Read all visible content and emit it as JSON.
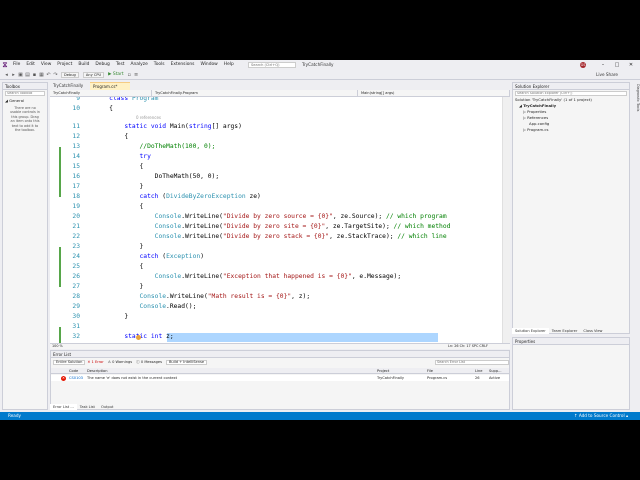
{
  "menu": {
    "items": [
      "File",
      "Edit",
      "View",
      "Project",
      "Build",
      "Debug",
      "Test",
      "Analyze",
      "Tools",
      "Extensions",
      "Window",
      "Help"
    ],
    "search_placeholder": "Search (Ctrl+Q)",
    "window_title": "TryCatchFinally",
    "avatar": "GS",
    "win_controls": [
      "–",
      "□",
      "✕"
    ]
  },
  "toolbar": {
    "config": "Debug",
    "platform": "Any CPU",
    "start_label": "▶ Start",
    "live_share": "Live Share"
  },
  "toolbox": {
    "title": "Toolbox",
    "search_placeholder": "Search Toolbox",
    "group": "◢ General",
    "message": "There are no usable controls in this group. Drag an item onto this text to add it to the toolbox."
  },
  "editor": {
    "tabs": [
      "TryCatchFinally",
      "Program.cs*"
    ],
    "nav": [
      "TryCatchFinally",
      "TryCatchFinally.Program",
      "Main(string[] args)"
    ],
    "refs_label": "0 references",
    "lines": [
      {
        "n": "9",
        "tokens": [
          {
            "t": "    ",
            "c": ""
          },
          {
            "t": "class",
            "c": "kw"
          },
          {
            "t": " ",
            "c": ""
          },
          {
            "t": "Program",
            "c": "ty"
          }
        ]
      },
      {
        "n": "10",
        "tokens": [
          {
            "t": "    {",
            "c": ""
          }
        ]
      },
      {
        "n": "11",
        "tokens": [
          {
            "t": "        ",
            "c": ""
          },
          {
            "t": "static",
            "c": "kw"
          },
          {
            "t": " ",
            "c": ""
          },
          {
            "t": "void",
            "c": "kw"
          },
          {
            "t": " Main(",
            "c": ""
          },
          {
            "t": "string",
            "c": "kw"
          },
          {
            "t": "[] args)",
            "c": ""
          }
        ]
      },
      {
        "n": "12",
        "tokens": [
          {
            "t": "        {",
            "c": ""
          }
        ]
      },
      {
        "n": "13",
        "tokens": [
          {
            "t": "            ",
            "c": ""
          },
          {
            "t": "//DoTheMath(100, 0);",
            "c": "cm"
          }
        ]
      },
      {
        "n": "14",
        "tokens": [
          {
            "t": "            ",
            "c": ""
          },
          {
            "t": "try",
            "c": "kw"
          }
        ]
      },
      {
        "n": "15",
        "tokens": [
          {
            "t": "            {",
            "c": ""
          }
        ]
      },
      {
        "n": "16",
        "tokens": [
          {
            "t": "                DoTheMath(50, 0);",
            "c": ""
          }
        ]
      },
      {
        "n": "17",
        "tokens": [
          {
            "t": "            }",
            "c": ""
          }
        ]
      },
      {
        "n": "18",
        "tokens": [
          {
            "t": "            ",
            "c": ""
          },
          {
            "t": "catch",
            "c": "kw"
          },
          {
            "t": " (",
            "c": ""
          },
          {
            "t": "DivideByZeroException",
            "c": "ty"
          },
          {
            "t": " ze)",
            "c": ""
          }
        ]
      },
      {
        "n": "19",
        "tokens": [
          {
            "t": "            {",
            "c": ""
          }
        ]
      },
      {
        "n": "20",
        "tokens": [
          {
            "t": "                ",
            "c": ""
          },
          {
            "t": "Console",
            "c": "ty"
          },
          {
            "t": ".WriteLine(",
            "c": ""
          },
          {
            "t": "\"Divide by zero source = {0}\"",
            "c": "str"
          },
          {
            "t": ", ze.Source); ",
            "c": ""
          },
          {
            "t": "// which program",
            "c": "cm"
          }
        ]
      },
      {
        "n": "21",
        "tokens": [
          {
            "t": "                ",
            "c": ""
          },
          {
            "t": "Console",
            "c": "ty"
          },
          {
            "t": ".WriteLine(",
            "c": ""
          },
          {
            "t": "\"Divide by zero site = {0}\"",
            "c": "str"
          },
          {
            "t": ", ze.TargetSite); ",
            "c": ""
          },
          {
            "t": "// which method",
            "c": "cm"
          }
        ]
      },
      {
        "n": "22",
        "tokens": [
          {
            "t": "                ",
            "c": ""
          },
          {
            "t": "Console",
            "c": "ty"
          },
          {
            "t": ".WriteLine(",
            "c": ""
          },
          {
            "t": "\"Divide by zero stack = {0}\"",
            "c": "str"
          },
          {
            "t": ", ze.StackTrace); ",
            "c": ""
          },
          {
            "t": "// which line",
            "c": "cm"
          }
        ]
      },
      {
        "n": "23",
        "tokens": [
          {
            "t": "            }",
            "c": ""
          }
        ]
      },
      {
        "n": "24",
        "tokens": [
          {
            "t": "            ",
            "c": ""
          },
          {
            "t": "catch",
            "c": "kw"
          },
          {
            "t": " (",
            "c": ""
          },
          {
            "t": "Exception",
            "c": "ty"
          },
          {
            "t": ")",
            "c": ""
          }
        ]
      },
      {
        "n": "25",
        "tokens": [
          {
            "t": "            {",
            "c": ""
          }
        ]
      },
      {
        "n": "26",
        "tokens": [
          {
            "t": "                ",
            "c": ""
          },
          {
            "t": "Console",
            "c": "ty"
          },
          {
            "t": ".WriteLine(",
            "c": ""
          },
          {
            "t": "\"Exception that happened is = {0}\"",
            "c": "str"
          },
          {
            "t": ", e.Message);",
            "c": ""
          }
        ]
      },
      {
        "n": "27",
        "tokens": [
          {
            "t": "            }",
            "c": ""
          }
        ]
      },
      {
        "n": "28",
        "tokens": [
          {
            "t": "            ",
            "c": ""
          },
          {
            "t": "Console",
            "c": "ty"
          },
          {
            "t": ".WriteLine(",
            "c": ""
          },
          {
            "t": "\"Math result is = {0}\"",
            "c": "str"
          },
          {
            "t": ", z);",
            "c": ""
          }
        ]
      },
      {
        "n": "29",
        "tokens": [
          {
            "t": "            ",
            "c": ""
          },
          {
            "t": "Console",
            "c": "ty"
          },
          {
            "t": ".Read();",
            "c": ""
          }
        ]
      },
      {
        "n": "30",
        "tokens": [
          {
            "t": "        }",
            "c": ""
          }
        ]
      },
      {
        "n": "31",
        "tokens": [
          {
            "t": "",
            "c": ""
          }
        ]
      },
      {
        "n": "32",
        "tokens": [
          {
            "t": "        ",
            "c": ""
          },
          {
            "t": "static",
            "c": "kw"
          },
          {
            "t": " ",
            "c": ""
          },
          {
            "t": "int",
            "c": "kw"
          },
          {
            "t": " z;",
            "c": ""
          }
        ]
      }
    ],
    "zoom": "100 %",
    "caret_info": "Ln: 26   Ch: 17   SPC   CRLF"
  },
  "error_list": {
    "title": "Error List",
    "scope": "Entire Solution",
    "errors": "✕ 1 Error",
    "warnings": "⚠ 0 Warnings",
    "messages": "ⓘ 0 Messages",
    "build_filter": "Build + IntelliSense",
    "search_placeholder": "Search Error List",
    "columns": [
      "Code",
      "Description",
      "Project",
      "File",
      "Line",
      "Supp..."
    ],
    "row": {
      "code": "CS0103",
      "description": "The name 'e' does not exist in the current context",
      "project": "TryCatchFinally",
      "file": "Program.cs",
      "line": "26",
      "suppression": "Active"
    },
    "tabs": [
      "Error List ...",
      "Task List",
      "Output"
    ]
  },
  "solution_explorer": {
    "title": "Solution Explorer",
    "search_placeholder": "Search Solution Explorer (Ctrl+;)",
    "items": [
      "Solution 'TryCatchFinally' (1 of 1 project)",
      "◢ TryCatchFinally",
      "▷ Properties",
      "▷ References",
      "App.config",
      "▷ Program.cs"
    ],
    "tabs": [
      "Solution Explorer",
      "Team Explorer",
      "Class View"
    ]
  },
  "properties": {
    "title": "Properties"
  },
  "right_dock": "Diagnostic Tools",
  "status": {
    "left": "Ready",
    "right": "↑ Add to Source Control ▴"
  }
}
